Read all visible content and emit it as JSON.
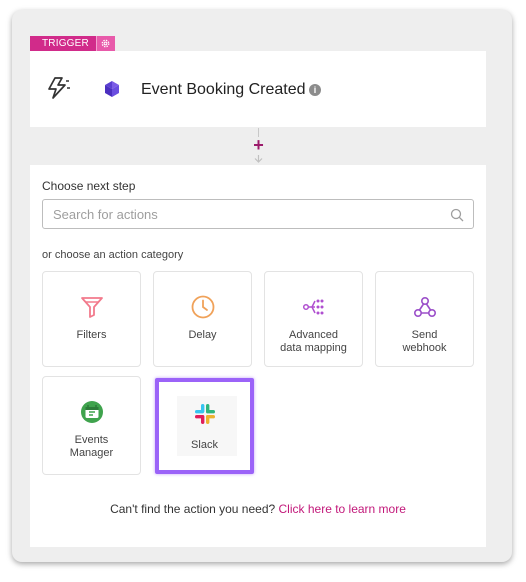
{
  "trigger": {
    "badge_label": "TRIGGER",
    "event_title": "Event Booking Created",
    "info_glyph": "i"
  },
  "connector": {
    "plus_glyph": "+"
  },
  "next_step": {
    "choose_label": "Choose next step",
    "search_placeholder": "Search for actions",
    "category_label": "or choose an action category",
    "categories": [
      {
        "label": "Filters",
        "icon": "funnel-icon"
      },
      {
        "label": "Delay",
        "icon": "clock-icon"
      },
      {
        "label": "Advanced\ndata mapping",
        "icon": "data-mapping-icon"
      },
      {
        "label": "Send\nwebhook",
        "icon": "webhook-icon"
      },
      {
        "label": "Events\nManager",
        "icon": "events-manager-icon"
      },
      {
        "label": "Slack",
        "icon": "slack-icon"
      }
    ],
    "help_text": "Can't find the action you need?",
    "help_link": "Click here to learn more"
  },
  "colors": {
    "brand_pink": "#d12b8a",
    "plus_purple": "#9c1a6b",
    "highlight_violet": "#9b63f8",
    "link": "#c2187a"
  }
}
